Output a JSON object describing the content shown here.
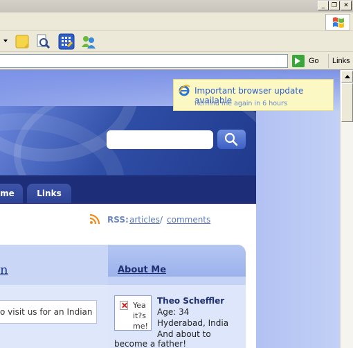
{
  "window": {
    "minimize_glyph": "_",
    "restore_glyph": "❐",
    "close_glyph": "✕"
  },
  "toolbar": {
    "icons": [
      "dropdown-arrow",
      "notes-icon",
      "research-icon",
      "messenger-grid-icon",
      "contacts-icon"
    ]
  },
  "address_bar": {
    "value": "",
    "go_label": "Go",
    "links_label": "Links"
  },
  "notification": {
    "title": "Important browser update available",
    "subtitle": "Remind me again in 6 hours"
  },
  "site": {
    "search": {
      "placeholder": ""
    },
    "nav": {
      "tabs": [
        "me",
        "Links"
      ]
    },
    "rss": {
      "label": "RSS:",
      "articles_link": "articles",
      "separator": "/",
      "comments_link": "comments"
    },
    "post": {
      "title": "n",
      "text": "o visit us for an Indian"
    },
    "sidebar": {
      "title": "About Me",
      "avatar_alt": "Yea it?s me!",
      "name": "Theo Scheffler",
      "age": "Age: 34",
      "location": "Hyderabad, India",
      "line4": "And about to",
      "line5": "become a father!"
    }
  },
  "colors": {
    "accent": "#2c5cc4",
    "header_dark": "#1e2d78",
    "balloon": "#fbf8c4"
  }
}
